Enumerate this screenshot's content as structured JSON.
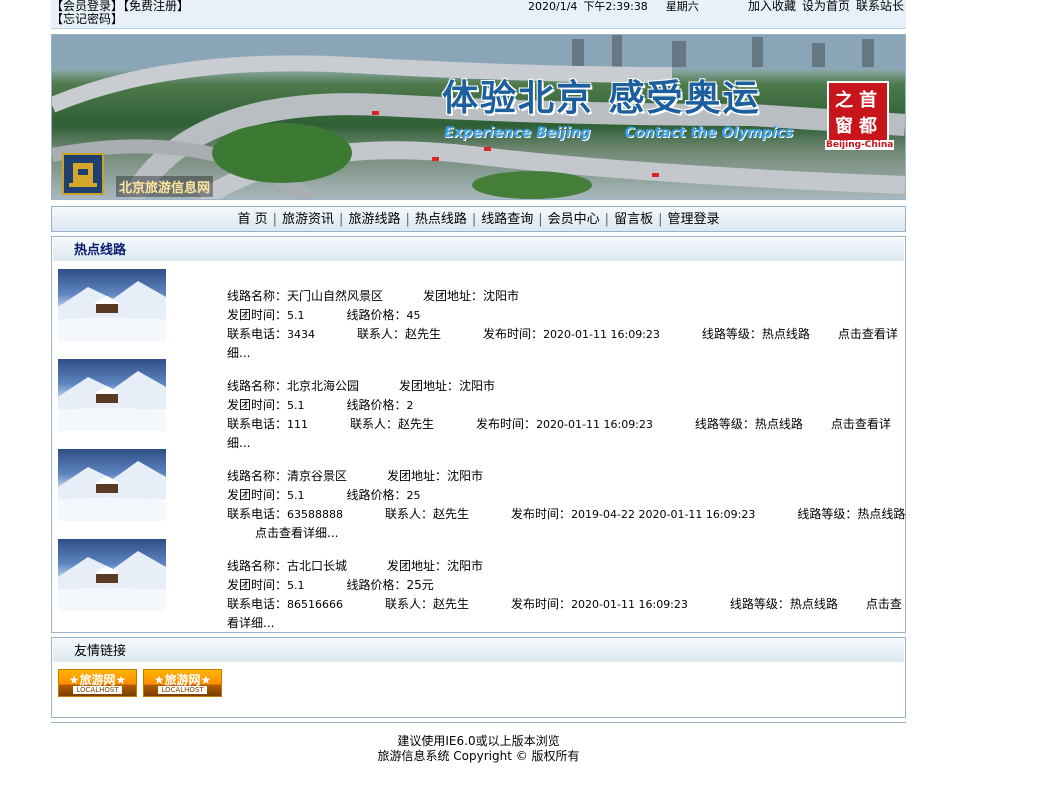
{
  "top": {
    "member_login": "【会员登录】",
    "register": "【免费注册】",
    "forgot": "【忘记密码】",
    "date": "2020/1/4",
    "time": "下午2:39:38",
    "weekday": "星期六",
    "favorite": "加入收藏",
    "homepage": "设为首页",
    "contact": "联系站长"
  },
  "banner": {
    "slogan_cn": "体验北京 感受奥运",
    "slogan_en_1": "Experience Beijing",
    "slogan_en_2": "Contact the Olympics",
    "site_name": "北京旅游信息网",
    "seal_1": "首",
    "seal_2": "都",
    "seal_3": "之",
    "seal_4": "窗",
    "seal_en": "Beijing-China"
  },
  "nav": [
    {
      "label": "首 页"
    },
    {
      "label": "旅游资讯"
    },
    {
      "label": "旅游线路"
    },
    {
      "label": "热点线路"
    },
    {
      "label": "线路查询"
    },
    {
      "label": "会员中心"
    },
    {
      "label": "留言板"
    },
    {
      "label": "管理登录"
    }
  ],
  "hot": {
    "title": "热点线路",
    "labels": {
      "name": "线路名称：",
      "origin": "发团地址：",
      "depart": "发团时间：",
      "price": "线路价格：",
      "phone": "联系电话：",
      "contact": "联系人：",
      "publish": "发布时间：",
      "level": "线路等级：",
      "more": "点击查看详细..."
    },
    "routes": [
      {
        "name": "天门山自然风景区",
        "origin": "沈阳市",
        "depart": "5.1",
        "price": "45",
        "phone": "3434",
        "contact": "赵先生",
        "publish": "2020-01-11 16:09:23",
        "level": "热点线路"
      },
      {
        "name": "北京北海公园",
        "origin": "沈阳市",
        "depart": "5.1",
        "price": "2",
        "phone": "111",
        "contact": "赵先生",
        "publish": "2020-01-11 16:09:23",
        "level": "热点线路"
      },
      {
        "name": "清京谷景区",
        "origin": "沈阳市",
        "depart": "5.1",
        "price": "25",
        "phone": "63588888",
        "contact": "赵先生",
        "publish": "2019-04-22 2020-01-11 16:09:23",
        "level": "热点线路"
      },
      {
        "name": "古北口长城",
        "origin": "沈阳市",
        "depart": "5.1",
        "price": "25元",
        "phone": "86516666",
        "contact": "赵先生",
        "publish": "2020-01-11 16:09:23",
        "level": "热点线路"
      }
    ]
  },
  "links": {
    "title": "友情链接",
    "items": [
      {
        "title": "★旅游网★",
        "sub": "LOCALHOST"
      },
      {
        "title": "★旅游网★",
        "sub": "LOCALHOST"
      }
    ]
  },
  "footer": {
    "line1": "建议使用IE6.0或以上版本浏览",
    "line2": "旅游信息系统 Copyright © 版权所有"
  }
}
